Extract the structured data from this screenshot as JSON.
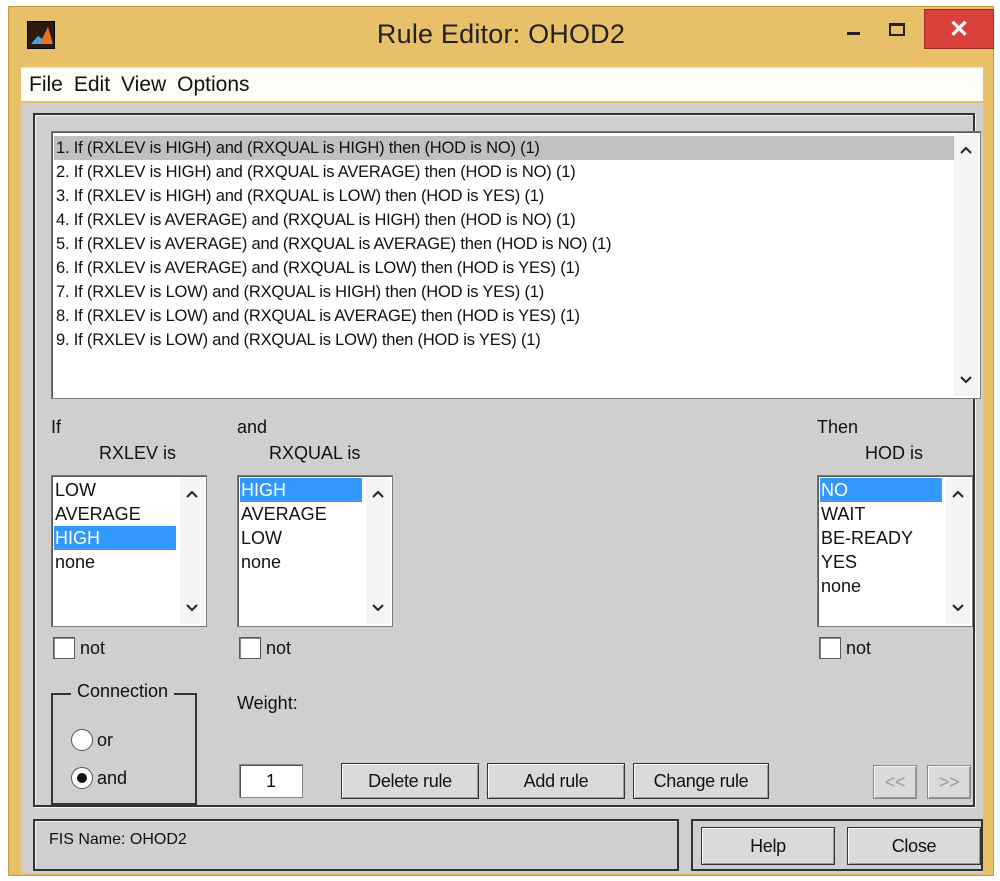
{
  "window": {
    "title": "Rule Editor: OHOD2",
    "close_glyph": "✕"
  },
  "menu": [
    "File",
    "Edit",
    "View",
    "Options"
  ],
  "rules": [
    "1. If (RXLEV is HIGH) and (RXQUAL is HIGH) then (HOD is NO) (1)",
    "2. If (RXLEV is HIGH) and (RXQUAL is AVERAGE) then (HOD is NO) (1)",
    "3. If (RXLEV is HIGH) and (RXQUAL is LOW) then (HOD is YES) (1)",
    "4. If (RXLEV is AVERAGE) and (RXQUAL is HIGH) then (HOD is NO) (1)",
    "5. If (RXLEV is AVERAGE) and (RXQUAL is AVERAGE) then (HOD is NO) (1)",
    "6. If (RXLEV is AVERAGE) and (RXQUAL is LOW) then (HOD is YES) (1)",
    "7. If (RXLEV is LOW) and (RXQUAL is HIGH) then (HOD is YES) (1)",
    "8. If (RXLEV is LOW) and (RXQUAL is AVERAGE) then (HOD is YES) (1)",
    "9. If (RXLEV is LOW) and (RXQUAL is LOW) then (HOD is YES) (1)"
  ],
  "selected_rule": 1,
  "antecedent1": {
    "keyword": "If",
    "var_label": "RXLEV is",
    "options": [
      "LOW",
      "AVERAGE",
      "HIGH",
      "none"
    ],
    "selected": "HIGH",
    "not_label": "not"
  },
  "antecedent2": {
    "keyword": "and",
    "var_label": "RXQUAL is",
    "options": [
      "HIGH",
      "AVERAGE",
      "LOW",
      "none"
    ],
    "selected": "HIGH",
    "not_label": "not"
  },
  "consequent": {
    "keyword": "Then",
    "var_label": "HOD is",
    "options": [
      "NO",
      "WAIT",
      "BE-READY",
      "YES",
      "none"
    ],
    "selected": "NO",
    "not_label": "not"
  },
  "connection": {
    "title": "Connection",
    "options": [
      "or",
      "and"
    ],
    "selected": "and"
  },
  "weight": {
    "label": "Weight:",
    "value": "1"
  },
  "buttons": {
    "delete": "Delete rule",
    "add": "Add rule",
    "change": "Change rule",
    "prev": "<<",
    "next": ">>",
    "help": "Help",
    "close": "Close"
  },
  "status": "FIS Name: OHOD2",
  "colors": {
    "title_bar": "#e9c06a",
    "client": "#cfcfcf",
    "selection": "#3399ff",
    "close_button": "#d9413a"
  }
}
